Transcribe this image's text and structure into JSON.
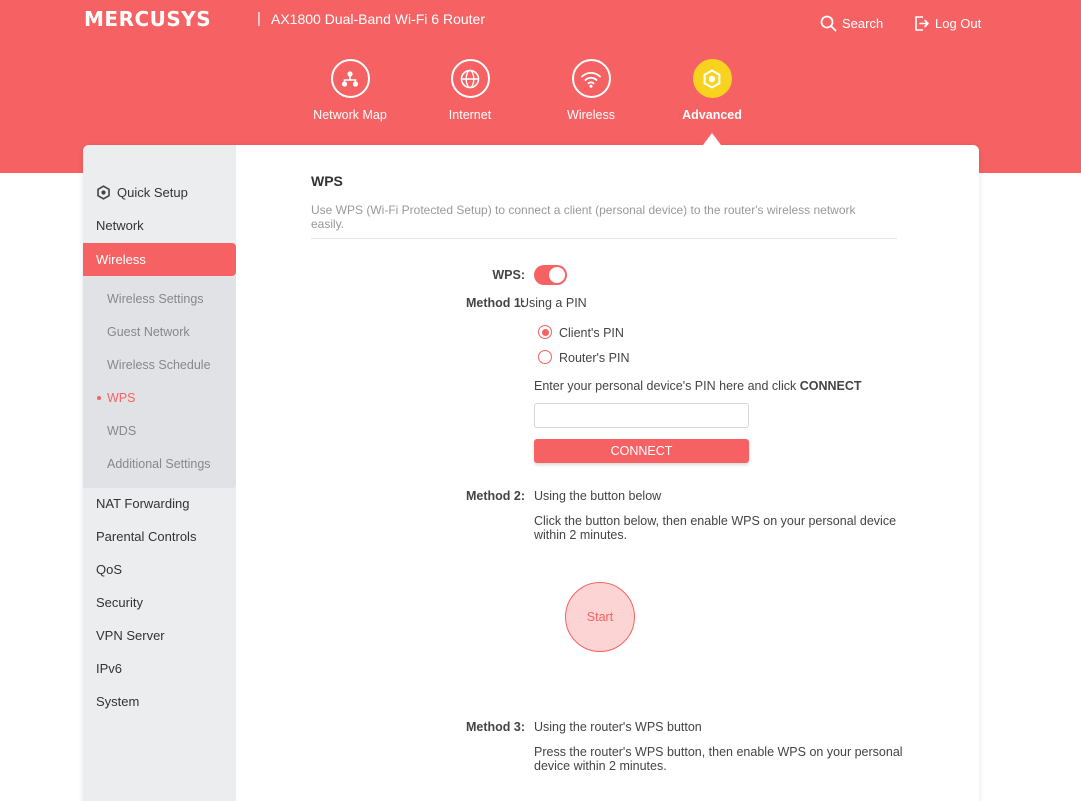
{
  "header": {
    "brand": "MERCUSYS",
    "separator": "|",
    "model": "AX1800 Dual-Band Wi-Fi 6 Router",
    "search_label": "Search",
    "logout_label": "Log Out"
  },
  "nav": [
    {
      "label": "Network Map",
      "icon": "network-map-icon"
    },
    {
      "label": "Internet",
      "icon": "globe-icon"
    },
    {
      "label": "Wireless",
      "icon": "wifi-icon"
    },
    {
      "label": "Advanced",
      "icon": "gear-icon",
      "active": true
    }
  ],
  "sidebar": {
    "items": [
      {
        "label": "Quick Setup",
        "icon": "gear-icon"
      },
      {
        "label": "Network"
      },
      {
        "label": "Wireless",
        "active": true
      },
      {
        "label": "NAT Forwarding"
      },
      {
        "label": "Parental Controls"
      },
      {
        "label": "QoS"
      },
      {
        "label": "Security"
      },
      {
        "label": "VPN Server"
      },
      {
        "label": "IPv6"
      },
      {
        "label": "System"
      }
    ],
    "wireless_sub": [
      {
        "label": "Wireless Settings"
      },
      {
        "label": "Guest Network"
      },
      {
        "label": "Wireless Schedule"
      },
      {
        "label": "WPS",
        "active": true
      },
      {
        "label": "WDS"
      },
      {
        "label": "Additional Settings"
      }
    ]
  },
  "content": {
    "title": "WPS",
    "description": "Use WPS (Wi-Fi Protected Setup) to connect a client (personal device) to the router's wireless network easily.",
    "wps_label": "WPS:",
    "wps_enabled": true,
    "method1": {
      "label": "Method 1:",
      "text": "Using a PIN",
      "options": [
        {
          "label": "Client's PIN",
          "checked": true
        },
        {
          "label": "Router's PIN",
          "checked": false
        }
      ],
      "instruction": "Enter your personal device's PIN here and click",
      "instruction_bold": "CONNECT",
      "pin_value": "",
      "connect_label": "CONNECT"
    },
    "method2": {
      "label": "Method 2:",
      "text": "Using the button below",
      "instruction": "Click the button below, then enable WPS on your personal device within 2 minutes.",
      "start_label": "Start"
    },
    "method3": {
      "label": "Method 3:",
      "text": "Using the router's WPS button",
      "instruction": "Press the router's WPS button, then enable WPS on your personal device within 2 minutes."
    }
  },
  "colors": {
    "brand": "#f66263",
    "active_nav": "#f7d21e",
    "sidebar_bg": "#ecedef"
  }
}
